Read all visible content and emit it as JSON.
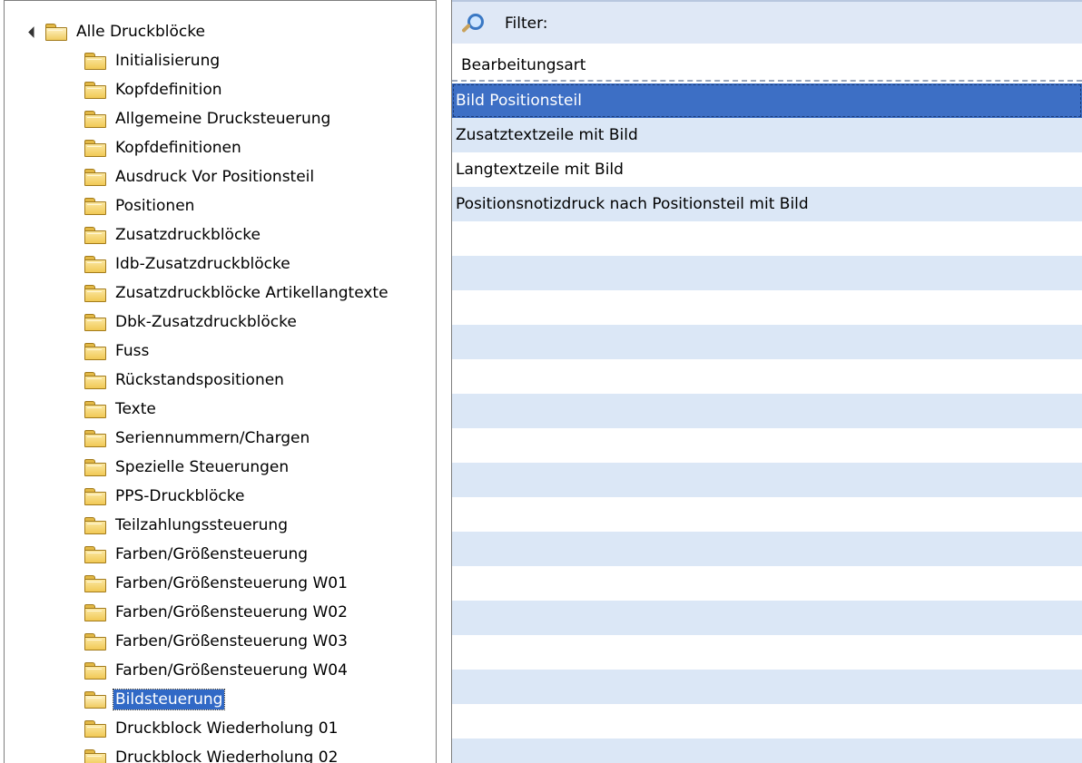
{
  "tree": {
    "root": {
      "label": "Alle Druckblöcke"
    },
    "items": [
      {
        "label": "Initialisierung",
        "selected": false
      },
      {
        "label": "Kopfdefinition",
        "selected": false
      },
      {
        "label": "Allgemeine Drucksteuerung",
        "selected": false
      },
      {
        "label": "Kopfdefinitionen",
        "selected": false
      },
      {
        "label": "Ausdruck Vor Positionsteil",
        "selected": false
      },
      {
        "label": "Positionen",
        "selected": false
      },
      {
        "label": "Zusatzdruckblöcke",
        "selected": false
      },
      {
        "label": "Idb-Zusatzdruckblöcke",
        "selected": false
      },
      {
        "label": "Zusatzdruckblöcke Artikellangtexte",
        "selected": false
      },
      {
        "label": "Dbk-Zusatzdruckblöcke",
        "selected": false
      },
      {
        "label": "Fuss",
        "selected": false
      },
      {
        "label": "Rückstandspositionen",
        "selected": false
      },
      {
        "label": "Texte",
        "selected": false
      },
      {
        "label": "Seriennummern/Chargen",
        "selected": false
      },
      {
        "label": "Spezielle Steuerungen",
        "selected": false
      },
      {
        "label": "PPS-Druckblöcke",
        "selected": false
      },
      {
        "label": "Teilzahlungssteuerung",
        "selected": false
      },
      {
        "label": "Farben/Größensteuerung",
        "selected": false
      },
      {
        "label": "Farben/Größensteuerung W01",
        "selected": false
      },
      {
        "label": "Farben/Größensteuerung W02",
        "selected": false
      },
      {
        "label": "Farben/Größensteuerung W03",
        "selected": false
      },
      {
        "label": "Farben/Größensteuerung W04",
        "selected": false
      },
      {
        "label": "Bildsteuerung",
        "selected": true
      },
      {
        "label": "Druckblock Wiederholung 01",
        "selected": false
      },
      {
        "label": "Druckblock Wiederholung 02",
        "selected": false
      }
    ]
  },
  "list": {
    "filter_label": "Filter:",
    "filter_value": "",
    "column_header": "Bearbeitungsart",
    "rows": [
      {
        "label": "Bild Positionsteil",
        "selected": true
      },
      {
        "label": "Zusatztextzeile mit Bild",
        "selected": false
      },
      {
        "label": "Langtextzeile mit Bild",
        "selected": false
      },
      {
        "label": "Positionsnotizdruck nach Positionsteil mit Bild",
        "selected": false
      }
    ]
  },
  "colors": {
    "selection": "#3169c6",
    "row_alt": "#dbe7f6",
    "filter_bar": "#dfe8f6",
    "folder": "#f1c955"
  }
}
